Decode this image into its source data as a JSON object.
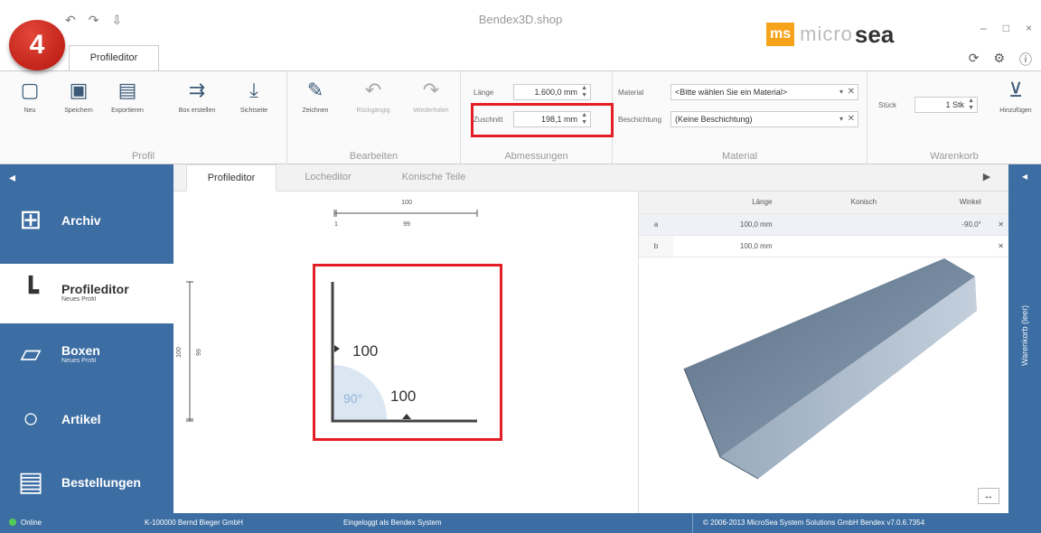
{
  "app": {
    "title": "Bendex3D.shop",
    "step_number": "4",
    "brand": {
      "ms": "ms",
      "micro": "micro",
      "sea": "sea"
    },
    "window_controls": [
      "–",
      "□",
      "×"
    ],
    "top_icons": [
      "refresh-icon",
      "gear-icon",
      "info-icon"
    ],
    "quick_access": [
      "↶",
      "↷",
      "⇩"
    ]
  },
  "ribbon": {
    "tab_label": "Profileditor",
    "groups": {
      "profil": {
        "label": "Profil",
        "buttons": [
          "Neu",
          "Speichern",
          "Exportieren",
          "Box erstellen",
          "Sichtseite"
        ]
      },
      "bearbeiten": {
        "label": "Bearbeiten",
        "buttons": [
          "Zeichnen",
          "Rückgängig",
          "Wiederholen"
        ]
      },
      "abmessungen": {
        "label": "Abmessungen",
        "laenge_label": "Länge",
        "laenge_value": "1.600,0 mm",
        "zuschnitt_label": "Zuschnitt",
        "zuschnitt_value": "198,1 mm"
      },
      "material": {
        "label": "Material",
        "material_label": "Material",
        "material_value": "<Bitte wählen Sie ein Material>",
        "beschichtung_label": "Beschichtung",
        "beschichtung_value": "(Keine Beschichtung)"
      },
      "warenkorb": {
        "label": "Warenkorb",
        "stueck_label": "Stück",
        "stueck_value": "1 Stk",
        "add_label": "Hinzufügen"
      }
    }
  },
  "nav": {
    "items": [
      {
        "title": "Archiv",
        "sub": "",
        "icon": "grid-icon"
      },
      {
        "title": "Profileditor",
        "sub": "Neues Profil",
        "icon": "profile-icon"
      },
      {
        "title": "Boxen",
        "sub": "Neues Profil",
        "icon": "box-icon"
      },
      {
        "title": "Artikel",
        "sub": "",
        "icon": "circle-icon"
      },
      {
        "title": "Bestellungen",
        "sub": "",
        "icon": "document-icon"
      }
    ]
  },
  "content_tabs": [
    "Profileditor",
    "Locheditor",
    "Konische Teile"
  ],
  "drawing": {
    "top_dim_total": "100",
    "top_dim_a": "1",
    "top_dim_b": "99",
    "left_dim_total": "100",
    "left_dim_a": "99",
    "segment_a_length": "100",
    "segment_b_length": "100",
    "angle": "90°"
  },
  "segments_table": {
    "headers": [
      "",
      "Länge",
      "Konisch",
      "Winkel"
    ],
    "rows": [
      {
        "key": "a",
        "laenge": "100,0 mm",
        "konisch": "",
        "winkel": "-90,0°"
      },
      {
        "key": "b",
        "laenge": "100,0 mm",
        "konisch": "",
        "winkel": ""
      }
    ]
  },
  "right_sidebar": {
    "label": "Warenkorb (leer)"
  },
  "status": {
    "online": "Online",
    "customer": "K-100000 Bernd Bieger GmbH",
    "login": "Eingeloggt als Bendex System",
    "copyright": "© 2006-2013 MicroSea System Solutions GmbH   Bendex v7.0.6.7354"
  },
  "colors": {
    "accent_blue": "#3d6ea3",
    "highlight_red": "#e31e24",
    "brand_orange": "#f7a21b",
    "model_steel": "#7f95ad"
  }
}
